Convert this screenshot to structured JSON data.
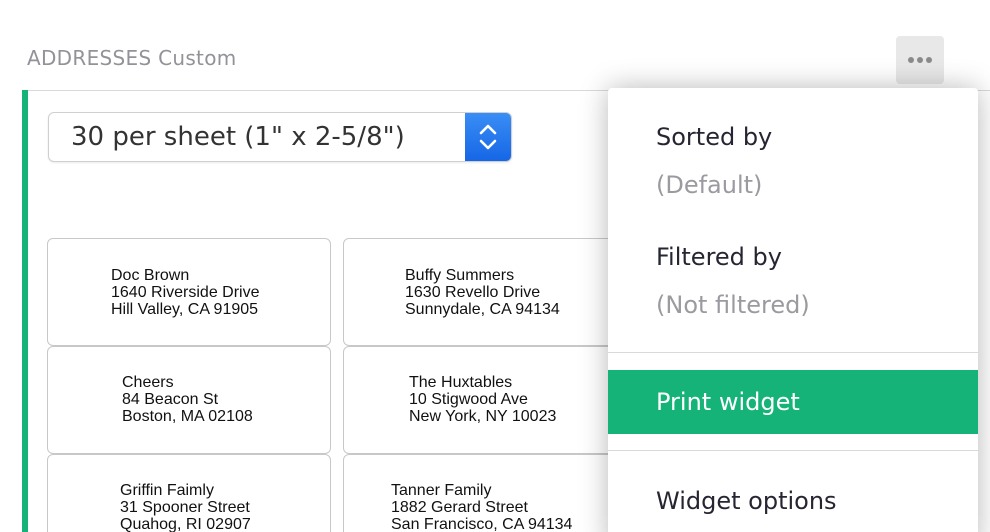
{
  "widget": {
    "title": "ADDRESSES Custom",
    "more_icon": "more-horizontal-icon",
    "accent_color": "#16b378"
  },
  "sheet_select": {
    "value": "30 per sheet (1\" x 2-5/8\")",
    "icon": "up-down-chevron-icon"
  },
  "labels": [
    {
      "name": "Doc Brown",
      "street": "1640 Riverside Drive",
      "city": "Hill Valley, CA 91905"
    },
    {
      "name": "Buffy Summers",
      "street": "1630 Revello Drive",
      "city": "Sunnydale, CA 94134"
    },
    {
      "name": "Cheers",
      "street": "84 Beacon St",
      "city": "Boston, MA 02108"
    },
    {
      "name": "The Huxtables",
      "street": "10 Stigwood Ave",
      "city": "New York, NY 10023"
    },
    {
      "name": "Griffin Faimly",
      "street": "31 Spooner Street",
      "city": "Quahog, RI 02907"
    },
    {
      "name": "Tanner Family",
      "street": "1882 Gerard Street",
      "city": "San Francisco, CA 94134"
    }
  ],
  "menu": {
    "sorted_by_label": "Sorted by",
    "sorted_by_value": "(Default)",
    "filtered_by_label": "Filtered by",
    "filtered_by_value": "(Not filtered)",
    "print_widget": "Print widget",
    "widget_options": "Widget options",
    "active_color": "#16b378"
  }
}
